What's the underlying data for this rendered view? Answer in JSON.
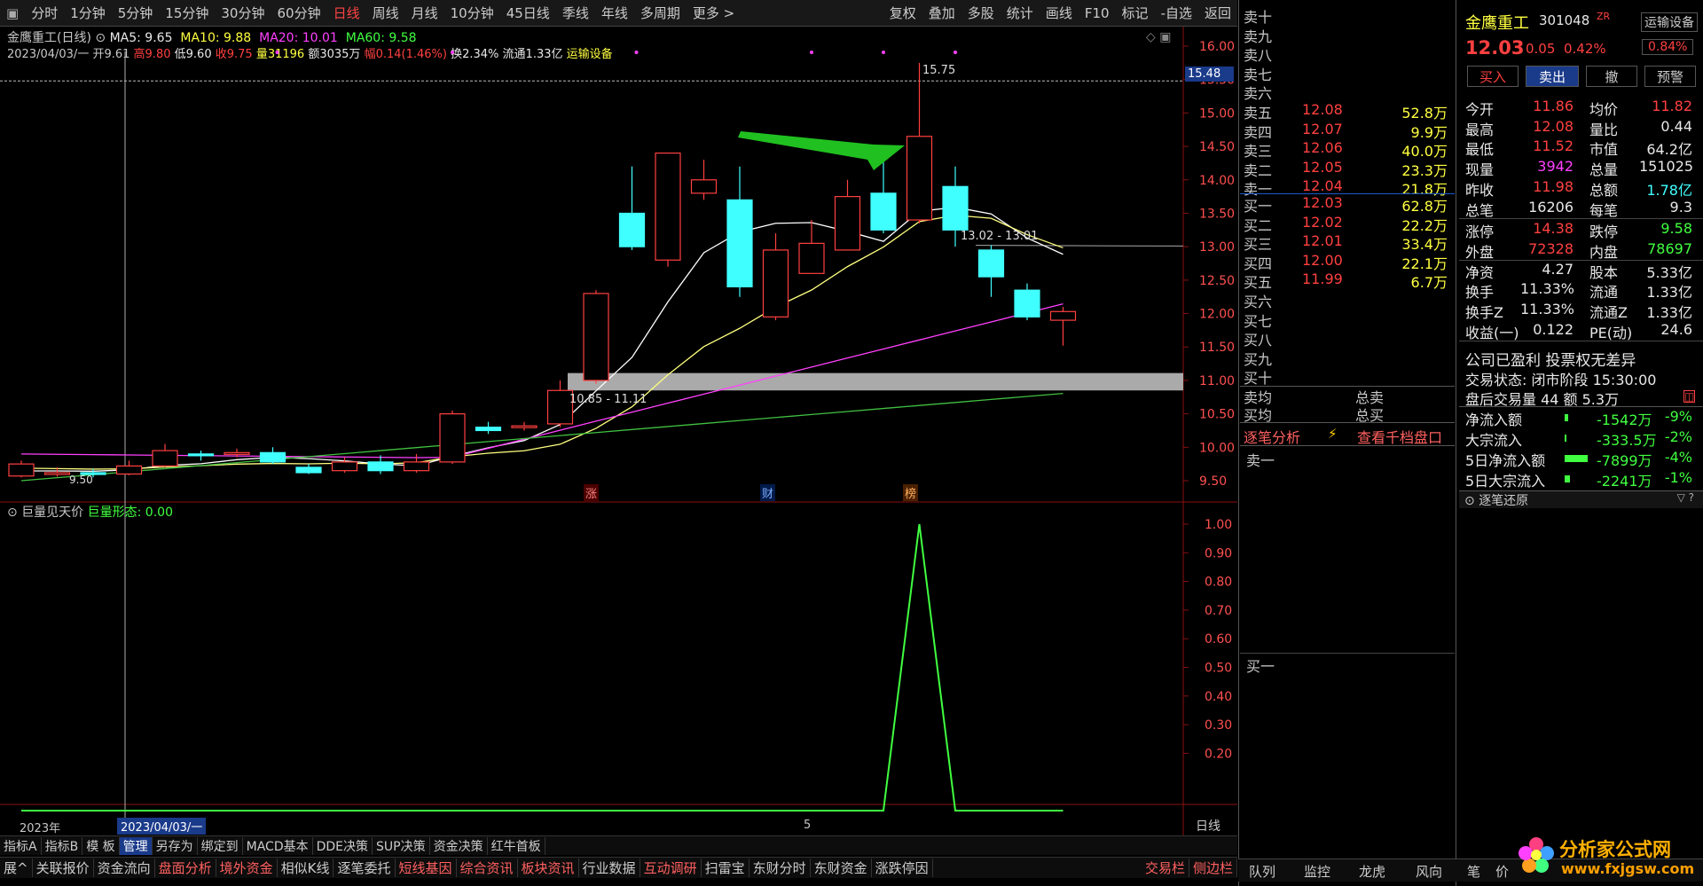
{
  "period_tabs": [
    "分时",
    "1分钟",
    "5分钟",
    "15分钟",
    "30分钟",
    "60分钟",
    "日线",
    "周线",
    "月线",
    "10分钟",
    "45日线",
    "季线",
    "年线",
    "多周期",
    "更多 >"
  ],
  "tool_tabs": [
    "复权",
    "叠加",
    "多股",
    "统计",
    "画线",
    "F10",
    "标记",
    "-自选",
    "返回"
  ],
  "stock": {
    "name": "金鹰重工",
    "code": "301048",
    "tag": "ZR",
    "price": "12.03",
    "change": "0.05",
    "pct": "0.42%",
    "badge_pct": "0.84%",
    "transport_tag": "运输设备"
  },
  "info_line1": {
    "title": "金鹰重工(日线)",
    "ma5": "MA5: 9.65",
    "ma10": "MA10: 9.88",
    "ma20": "MA20: 10.01",
    "ma60": "MA60: 9.58"
  },
  "info_line2": {
    "date": "2023/04/03/一",
    "open": "开9.61",
    "high": "高9.80",
    "low": "低9.60",
    "close": "收9.75",
    "vol": "量31196",
    "amt": "额3035万",
    "amp": "幅0.14(1.46%)",
    "turn": "换2.34%",
    "float": "流通1.33亿",
    "ind": "运输设备"
  },
  "price_axis": [
    "16.00",
    "15.50",
    "15.00",
    "14.50",
    "14.00",
    "13.50",
    "13.00",
    "12.50",
    "12.00",
    "11.50",
    "11.00",
    "10.50",
    "10.00",
    "9.50"
  ],
  "current_price_tag": "15.48",
  "annotations": {
    "high_label": "15.75",
    "low_label": "9.50",
    "band_label": "10.85 - 11.11",
    "flat_label": "13.02 - 13.01",
    "bubbles": [
      "涨",
      "财",
      "榜"
    ]
  },
  "candles": [
    {
      "o": 9.57,
      "c": 9.75,
      "h": 9.8,
      "l": 9.55
    },
    {
      "o": 9.6,
      "c": 9.62,
      "h": 9.7,
      "l": 9.56
    },
    {
      "o": 9.62,
      "c": 9.6,
      "h": 9.68,
      "l": 9.55
    },
    {
      "o": 9.6,
      "c": 9.72,
      "h": 9.8,
      "l": 9.58
    },
    {
      "o": 9.72,
      "c": 9.95,
      "h": 10.05,
      "l": 9.7
    },
    {
      "o": 9.9,
      "c": 9.88,
      "h": 9.95,
      "l": 9.8
    },
    {
      "o": 9.9,
      "c": 9.92,
      "h": 9.98,
      "l": 9.85
    },
    {
      "o": 9.92,
      "c": 9.78,
      "h": 10.0,
      "l": 9.75
    },
    {
      "o": 9.7,
      "c": 9.62,
      "h": 9.75,
      "l": 9.6
    },
    {
      "o": 9.65,
      "c": 9.78,
      "h": 9.85,
      "l": 9.62
    },
    {
      "o": 9.78,
      "c": 9.65,
      "h": 9.88,
      "l": 9.6
    },
    {
      "o": 9.65,
      "c": 9.78,
      "h": 9.9,
      "l": 9.62
    },
    {
      "o": 9.78,
      "c": 10.5,
      "h": 10.55,
      "l": 9.75
    },
    {
      "o": 10.3,
      "c": 10.25,
      "h": 10.38,
      "l": 10.2
    },
    {
      "o": 10.3,
      "c": 10.32,
      "h": 10.38,
      "l": 10.25
    },
    {
      "o": 10.35,
      "c": 10.85,
      "h": 11.0,
      "l": 10.3
    },
    {
      "o": 11.0,
      "c": 12.3,
      "h": 12.35,
      "l": 10.95
    },
    {
      "o": 13.5,
      "c": 13.0,
      "h": 14.2,
      "l": 12.95
    },
    {
      "o": 12.8,
      "c": 14.4,
      "h": 14.4,
      "l": 12.7
    },
    {
      "o": 13.8,
      "c": 14.0,
      "h": 14.3,
      "l": 13.7
    },
    {
      "o": 13.7,
      "c": 12.4,
      "h": 14.2,
      "l": 12.25
    },
    {
      "o": 11.95,
      "c": 12.95,
      "h": 13.2,
      "l": 11.9
    },
    {
      "o": 12.6,
      "c": 13.05,
      "h": 13.4,
      "l": 12.6
    },
    {
      "o": 12.95,
      "c": 13.75,
      "h": 14.0,
      "l": 12.95
    },
    {
      "o": 13.8,
      "c": 13.25,
      "h": 14.4,
      "l": 13.2
    },
    {
      "o": 13.4,
      "c": 14.65,
      "h": 15.75,
      "l": 13.35
    },
    {
      "o": 13.9,
      "c": 13.25,
      "h": 14.2,
      "l": 13.0
    },
    {
      "o": 12.95,
      "c": 12.55,
      "h": 13.02,
      "l": 12.25
    },
    {
      "o": 12.35,
      "c": 11.95,
      "h": 12.45,
      "l": 11.9
    },
    {
      "o": 11.9,
      "c": 12.03,
      "h": 12.1,
      "l": 11.52
    }
  ],
  "indicator": {
    "name": "巨量见天价",
    "value_label": "巨量形态: 0.00",
    "axis": [
      "1.00",
      "0.90",
      "0.80",
      "0.70",
      "0.60",
      "0.50",
      "0.40",
      "0.30",
      "0.20"
    ]
  },
  "x_axis": {
    "year": "2023年",
    "date_cursor": "2023/04/03/一",
    "month": "5",
    "period": "日线"
  },
  "bottom_tabs1": [
    "指标A",
    "指标B",
    "模 板",
    "管理",
    "另存为",
    "绑定到",
    "MACD基本",
    "DDE决策",
    "SUP决策",
    "资金决策",
    "红牛首板"
  ],
  "bottom_tabs2": [
    "展^",
    "关联报价",
    "资金流向",
    "盘面分析",
    "境外资金",
    "相似K线",
    "逐笔委托",
    "短线基因",
    "综合资讯",
    "板块资讯",
    "行业数据",
    "互动调研",
    "扫雷宝",
    "东财分时",
    "东财资金",
    "涨跌停因"
  ],
  "bottom_right": [
    "交易栏",
    "侧边栏"
  ],
  "sell_orders": [
    {
      "label": "卖十",
      "price": "",
      "vol": ""
    },
    {
      "label": "卖九",
      "price": "",
      "vol": ""
    },
    {
      "label": "卖八",
      "price": "",
      "vol": ""
    },
    {
      "label": "卖七",
      "price": "",
      "vol": ""
    },
    {
      "label": "卖六",
      "price": "",
      "vol": ""
    },
    {
      "label": "卖五",
      "price": "12.08",
      "vol": "52.8万"
    },
    {
      "label": "卖四",
      "price": "12.07",
      "vol": "9.9万"
    },
    {
      "label": "卖三",
      "price": "12.06",
      "vol": "40.0万"
    },
    {
      "label": "卖二",
      "price": "12.05",
      "vol": "23.3万"
    },
    {
      "label": "卖一",
      "price": "12.04",
      "vol": "21.8万"
    }
  ],
  "buy_orders": [
    {
      "label": "买一",
      "price": "12.03",
      "vol": "62.8万"
    },
    {
      "label": "买二",
      "price": "12.02",
      "vol": "22.2万"
    },
    {
      "label": "买三",
      "price": "12.01",
      "vol": "33.4万"
    },
    {
      "label": "买四",
      "price": "12.00",
      "vol": "22.1万"
    },
    {
      "label": "买五",
      "price": "11.99",
      "vol": "6.7万"
    },
    {
      "label": "买六",
      "price": "",
      "vol": ""
    },
    {
      "label": "买七",
      "price": "",
      "vol": ""
    },
    {
      "label": "买八",
      "price": "",
      "vol": ""
    },
    {
      "label": "买九",
      "price": "",
      "vol": ""
    },
    {
      "label": "买十",
      "price": "",
      "vol": ""
    }
  ],
  "avg_rows": {
    "sell_avg": "卖均",
    "buy_avg": "买均",
    "total_sell": "总卖",
    "total_buy": "总买"
  },
  "tick_header": {
    "left": "逐笔分析",
    "right": "查看千档盘口"
  },
  "tick_labels": {
    "s1": "卖一",
    "b1": "买一"
  },
  "trade_buttons": [
    "买入",
    "卖出",
    "撤",
    "预警"
  ],
  "quote": [
    [
      "今开",
      "11.86",
      "均价",
      "11.82"
    ],
    [
      "最高",
      "12.08",
      "量比",
      "0.44"
    ],
    [
      "最低",
      "11.52",
      "市值",
      "64.2亿"
    ],
    [
      "现量",
      "3942",
      "总量",
      "151025"
    ],
    [
      "昨收",
      "11.98",
      "总额",
      "1.78亿"
    ],
    [
      "总笔",
      "16206",
      "每笔",
      "9.3"
    ],
    [
      "涨停",
      "14.38",
      "跌停",
      "9.58"
    ],
    [
      "外盘",
      "72328",
      "内盘",
      "78697"
    ],
    [
      "净资",
      "4.27",
      "股本",
      "5.33亿"
    ],
    [
      "换手",
      "11.33%",
      "流通",
      "1.33亿"
    ],
    [
      "换手Z",
      "11.33%",
      "流通Z",
      "1.33亿"
    ],
    [
      "收益(一)",
      "0.122",
      "PE(动)",
      "24.6"
    ]
  ],
  "company": {
    "line1": "公司已盈利 投票权无差异",
    "status": "交易状态: 闭市阶段 15:30:00",
    "after": "盘后交易量 44 额 5.3万"
  },
  "flows": [
    [
      "净流入额",
      "-1542万",
      "-9%"
    ],
    [
      "大宗流入",
      "-333.5万",
      "-2%"
    ],
    [
      "5日净流入额",
      "-7899万",
      "-4%"
    ],
    [
      "5日大宗流入",
      "-2241万",
      "-1%"
    ]
  ],
  "tick_restore": "逐笔还原",
  "right_bottom_tabs": [
    "队列",
    "监控",
    "龙虎",
    "风向",
    "笔",
    "价"
  ],
  "watermark": {
    "cn": "分析家公式网",
    "url": "www.fxjgsw.com"
  },
  "colors": {
    "up": "#ff4040",
    "down": "#40ffff",
    "ma5": "#ffffff",
    "ma10": "#ffff80",
    "ma20": "#ff40ff",
    "ma60": "#40c040",
    "indicator": "#40ff40"
  }
}
